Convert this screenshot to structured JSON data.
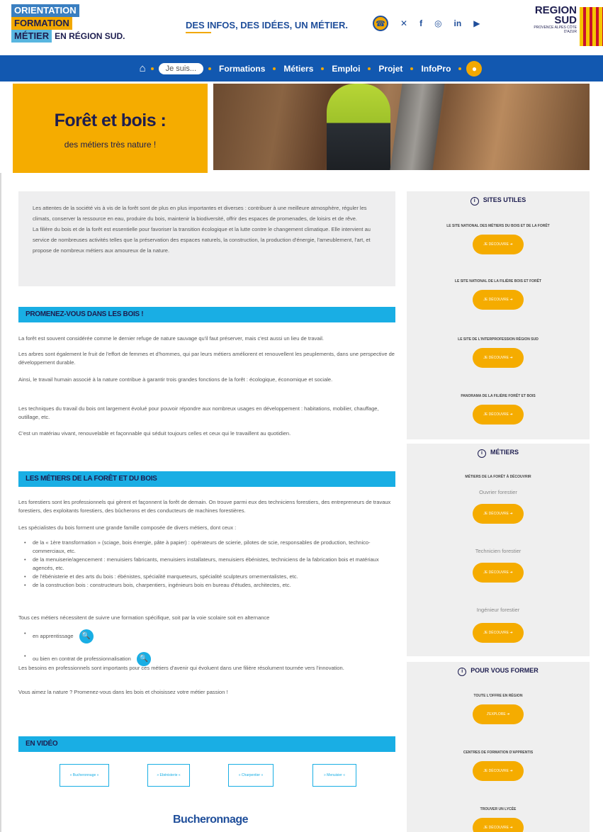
{
  "header": {
    "logo_l1": "ORIENTATION",
    "logo_l2": "FORMATION",
    "logo_l3": "MÉTIER",
    "logo_l3b": "EN RÉGION SUD.",
    "tagline": "DES INFOS, DES IDÉES, UN MÉTIER.",
    "socials": [
      "x-icon",
      "facebook-icon",
      "instagram-icon",
      "linkedin-icon",
      "youtube-icon"
    ],
    "region_l1": "REGION",
    "region_l2": "SUD",
    "region_l3": "PROVENCE ALPES CÔTE D'AZUR"
  },
  "nav": {
    "je_suis": "Je suis...",
    "items": [
      "Formations",
      "Métiers",
      "Emploi",
      "Projet",
      "InfoPro"
    ]
  },
  "hero": {
    "title": "Forêt et bois :",
    "subtitle": "des métiers très nature !"
  },
  "intro": {
    "p1": "Les attentes de la société vis à vis de la forêt sont de plus en plus importantes et diverses : contribuer à une meilleure atmosphère, réguler les climats, conserver la ressource en eau, produire du bois, maintenir la biodiversité, offrir des espaces de promenades, de loisirs et de rêve.",
    "p2": "La filière du bois et de la forêt est essentielle pour favoriser la transition écologique et la lutte contre le changement climatique. Elle intervient au service de nombreuses activités telles que la préservation des espaces naturels, la construction, la production d'énergie, l'ameublement, l'art, et propose de nombreux métiers aux amoureux de la nature."
  },
  "section1": {
    "title": "PROMENEZ-VOUS DANS LES BOIS !",
    "p1": "La forêt est souvent considérée comme le dernier refuge de nature sauvage qu'il faut préserver, mais c'est aussi un lieu de travail.",
    "p2": "Les arbres sont également le fruit de l'effort de femmes et d'hommes, qui par leurs métiers améliorent et renouvellent les peuplements, dans une perspective de développement durable.",
    "p3": "Ainsi, le travail humain associé à la nature contribue à garantir trois grandes fonctions de la forêt : écologique, économique et sociale.",
    "p4": "Les techniques du travail du bois ont largement évolué pour pouvoir répondre aux nombreux usages en développement : habitations, mobilier, chauffage, outillage, etc.",
    "p5": "C'est un matériau vivant, renouvelable et façonnable qui séduit toujours celles et ceux qui le travaillent au quotidien."
  },
  "section2": {
    "title": "LES MÉTIERS DE LA FORÊT ET DU BOIS",
    "p1": "Les forestiers sont les professionnels qui gèrent et façonnent la forêt de demain. On trouve parmi eux des techniciens forestiers, des entrepreneurs de travaux forestiers, des exploitants forestiers, des bûcherons et des conducteurs de machines forestières.",
    "p2": "Les spécialistes du bois forment une grande famille composée de divers métiers, dont ceux :",
    "bullets": [
      "de la « 1ère transformation » (sciage, bois énergie, pâte à papier) : opérateurs de scierie, pilotes de scie, responsables de production, technico-commerciaux, etc.",
      "de la menuiserie/agencement : menuisiers fabricants, menuisiers installateurs, menuisiers ébénistes, techniciens de la fabrication bois et matériaux agencés, etc.",
      "de l'ébénisterie et des arts du bois : ébénistes, spécialité marqueteurs, spécialité sculpteurs ornementalistes, etc.",
      "de la construction bois : constructeurs bois, charpentiers, ingénieurs bois en bureau d'études, architectes, etc."
    ],
    "p3": "Tous ces métiers nécessitent de suivre une formation spécifique, soit par la voie scolaire soit en alternance",
    "alt1": "en apprentissage",
    "alt2": "ou bien en contrat de professionnalisation",
    "p4": "Les besoins en professionnels sont importants pour ces métiers d'avenir qui évoluent dans une filière résolument tournée vers l'innovation.",
    "p5": "Vous aimez la nature ? Promenez-vous dans les bois et choisissez votre métier passion !"
  },
  "section3": {
    "title": "EN VIDÉO",
    "videos": [
      "» Bucheronnage «",
      "» Ebénisterie «",
      "» Charpentier «",
      "» Menuisier «"
    ],
    "video_title": "Bucheronnage"
  },
  "sidebar": {
    "sites": {
      "title": "SITES UTILES",
      "items": [
        "LE SITE NATIONAL DES MÉTIERS DU BOIS ET DE LA FORÊT",
        "LE SITE NATIONAL DE LA FILIÈRE BOIS ET FORÊT",
        "LE SITE DE L'INTERPROFESSION RÉGION SUD",
        "PANORAMA DE LA FILIÈRE FORÊT ET BOIS"
      ],
      "btn": "JE DÉCOUVRE ➜"
    },
    "metiers": {
      "title": "MÉTIERS",
      "label": "MÉTIERS DE LA FORÊT À DÉCOUVRIR",
      "jobs": [
        "Ouvrier forestier",
        "Technicien forestier",
        "Ingénieur forestier"
      ],
      "btn": "JE DÉCOUVRE ➜"
    },
    "former": {
      "title": "POUR VOUS FORMER",
      "items": [
        "TOUTE L'OFFRE EN RÉGION",
        "CENTRES DE FORMATION D'APPRENTIS",
        "TROUVER UN LYCÉE"
      ],
      "btn_first": "J'EXPLORE ➜",
      "btn": "JE DÉCOUVRE ➜"
    }
  }
}
